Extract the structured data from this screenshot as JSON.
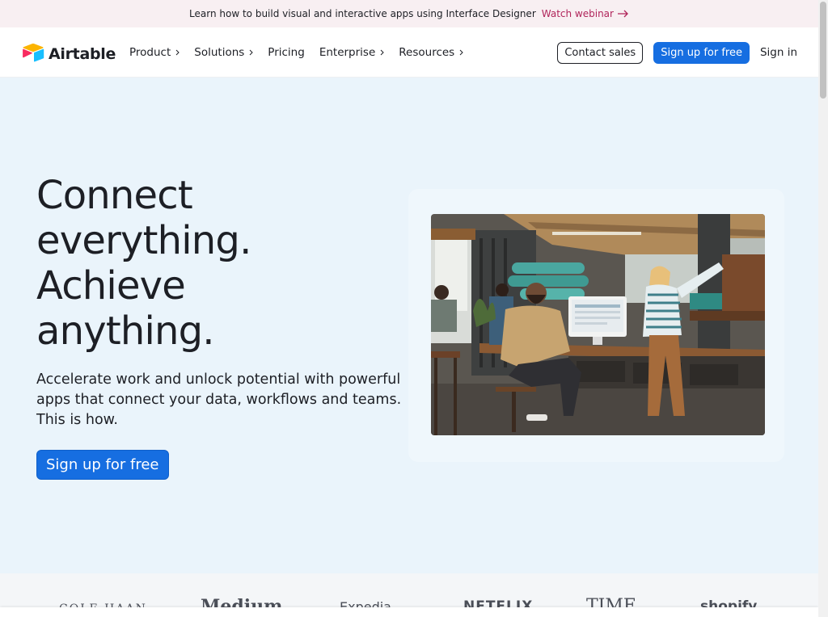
{
  "announcement": {
    "text": "Learn how to build visual and interactive apps using Interface Designer",
    "link_label": "Watch webinar"
  },
  "header": {
    "logo_text": "Airtable",
    "nav": [
      {
        "label": "Product",
        "has_chevron": true
      },
      {
        "label": "Solutions",
        "has_chevron": true
      },
      {
        "label": "Pricing",
        "has_chevron": false
      },
      {
        "label": "Enterprise",
        "has_chevron": true
      },
      {
        "label": "Resources",
        "has_chevron": true
      }
    ],
    "contact_label": "Contact sales",
    "signup_label": "Sign up for free",
    "signin_label": "Sign in"
  },
  "hero": {
    "headline": [
      "Connect",
      "everything.",
      "Achieve",
      "anything."
    ],
    "subtext": "Accelerate work and unlock potential with powerful apps that connect your data, workflows and teams. This is how.",
    "cta_label": "Sign up for free"
  },
  "customer_logos": [
    "COLE HAAN",
    "Medium",
    "Expedia",
    "NETFLIX",
    "TIME",
    "shopify"
  ],
  "colors": {
    "brand_blue": "#166ee1",
    "hero_bg": "#eaf4fb",
    "announce_bg": "#f8eff2",
    "link_accent": "#b0245a"
  }
}
